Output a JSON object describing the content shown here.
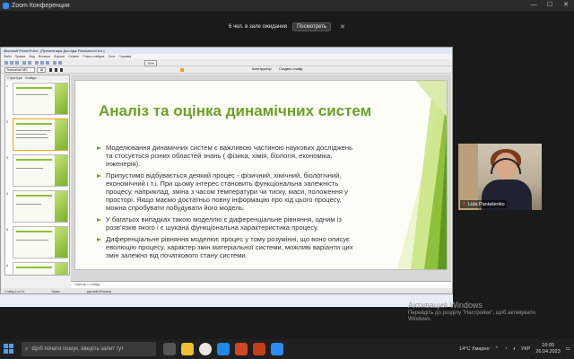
{
  "zoom": {
    "window_title": "Zoom Конференция",
    "waiting_text": "6 чел. в зале ожидания",
    "view_button": "Посмотреть"
  },
  "powerpoint": {
    "window_title": "Microsoft PowerPoint - [Презентація Дослідж Реальнсоні 8.b.]",
    "menu": [
      "Файл",
      "Правка",
      "Вид",
      "Вставка",
      "Формат",
      "Сервис",
      "Показ слайдов",
      "Окно",
      "Справка"
    ],
    "font_name": "Trebuchet MS",
    "font_size": "18",
    "zoom_level": "76%",
    "design_label": "Конструктор",
    "create_slide_label": "Создать слайд",
    "left_tabs": [
      "Структура",
      "Слайды"
    ],
    "notes_placeholder": "Заметки к слайду",
    "status": [
      "Слайд 2 из 11",
      "Грань",
      "русский (Россия)"
    ],
    "slide": {
      "title": "Аналіз та оцінка динамічних систем",
      "bullets": [
        "Моделювання динамічних систем є важливою частиною наукових досліджень та стосується різних областей знань ( фізика, хімія, біологія, економіка, інженерія).",
        "Припустимо відбувається деякий процес - фізичний, хімічний, біологічний, економічний і т.і. При цьому інтерес становить функціональна залежність процесу, наприклад, зміна з часом температури чи тиску, маси, положення у просторі. Якщо маємо достатньо повну інформацію про хід цього процесу, можна спробувати побудувати його модель.",
        "У багатьох випадках такою моделлю є диференціальне рівняння, одним із розв’язків якого і є шукана функціональна характеристика процесу.",
        "Диференціальне рівняння моделює процес у тому розумінні, що воно описує еволюцію процесу, характер змін матеріальної системи, можливі варіанти цих змін залежно від початкового стану системи."
      ]
    },
    "thumbnail_numbers": [
      "1",
      "2",
      "3",
      "4",
      "5",
      "6"
    ]
  },
  "video": {
    "participant_name": "Lida Pantalienko"
  },
  "activate_windows": {
    "title": "Активация Windows",
    "line1": "Перейдіть до розділу \"Настройки\", щоб активувати",
    "line2": "Windows."
  },
  "taskbar": {
    "search_placeholder": "Щоб почати пошук, введіть запит тут",
    "language": "УКР",
    "time": "16:00",
    "date": "26.04.2023",
    "weather": "14°C Хмарно"
  },
  "colors": {
    "title_green": "#6aa124",
    "zoom_blue": "#2d8cff"
  }
}
